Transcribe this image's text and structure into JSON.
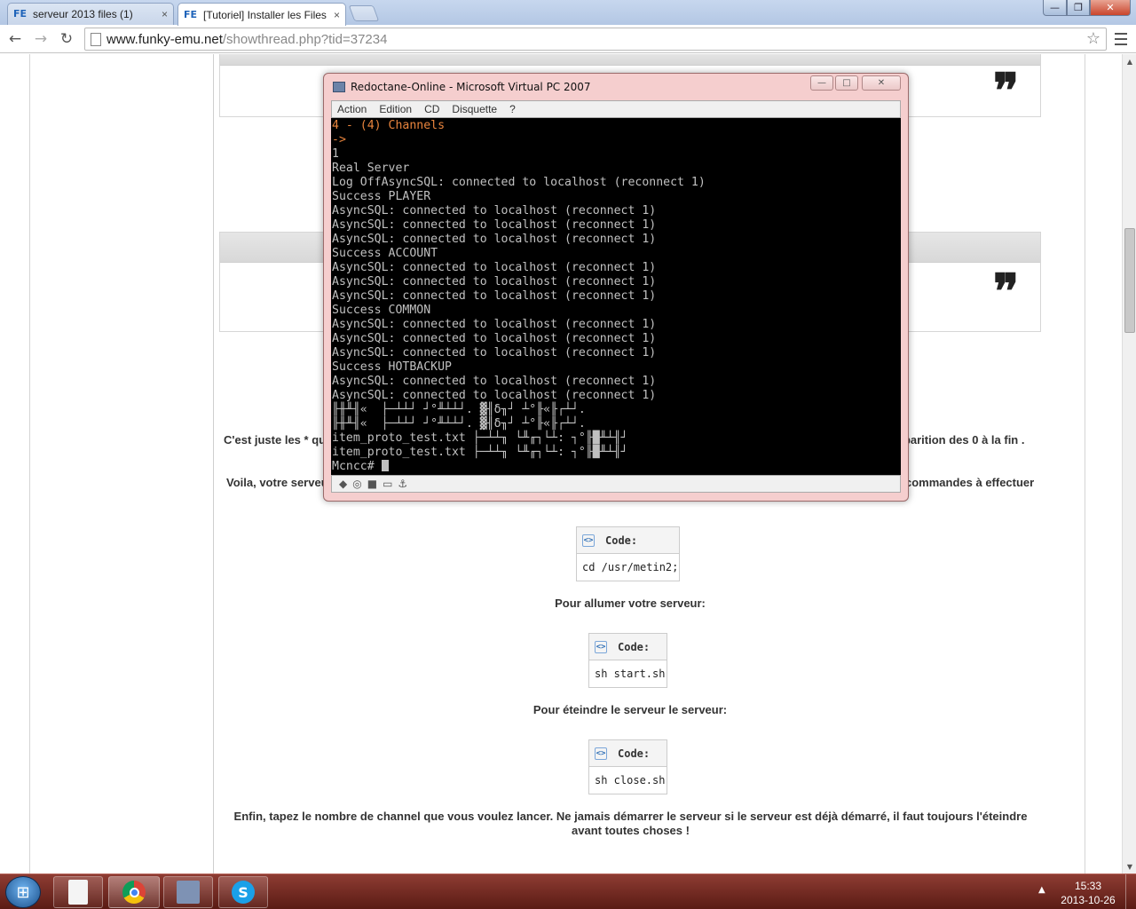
{
  "browser": {
    "tabs": [
      {
        "label": "serveur 2013 files (1)",
        "favicon": "FE",
        "close": "×"
      },
      {
        "label": "[Tutoriel] Installer les Files",
        "favicon": "FE",
        "close": "×"
      }
    ],
    "window_controls": {
      "minimize": "—",
      "maximize": "❐",
      "close": "✕"
    },
    "nav": {
      "back": "←",
      "forward": "→",
      "reload": "↻"
    },
    "url_host": "www.funky-emu.net",
    "url_path": "/showthread.php?tid=37234",
    "star": "☆"
  },
  "page": {
    "quote_mark": "❞",
    "para1_left": "C'est juste les * qu",
    "para1_right": "pparition des 0 à la fin .",
    "para2_left": "Voila, votre serveu",
    "para2_right": "commandes à effectuer",
    "code_label": "Code:",
    "code_icon": "<>",
    "code1": "cd /usr/metin2;",
    "label_start": "Pour allumer votre serveur:",
    "code2": "sh start.sh",
    "label_stop": "Pour éteindre le serveur le serveur:",
    "code3": "sh close.sh",
    "final_text": "Enfin, tapez le nombre de channel que vous voulez lancer. Ne jamais démarrer le serveur si le serveur est déjà démarré, il faut toujours l'éteindre avant toutes choses !"
  },
  "vpc": {
    "title": "Redoctane-Online - Microsoft Virtual PC 2007",
    "buttons": {
      "minimize": "—",
      "maximize": "□",
      "close": "✕"
    },
    "menu": [
      "Action",
      "Edition",
      "CD",
      "Disquette",
      "?"
    ],
    "console_lines": [
      {
        "text": "4 - (4) Channels",
        "color": "orange"
      },
      {
        "text": "->",
        "color": "orange"
      },
      {
        "text": "1",
        "color": "gray"
      },
      {
        "text": "Real Server",
        "color": "gray"
      },
      {
        "text": "Log OffAsyncSQL: connected to localhost (reconnect 1)",
        "color": "gray"
      },
      {
        "text": "Success PLAYER",
        "color": "gray"
      },
      {
        "text": "AsyncSQL: connected to localhost (reconnect 1)",
        "color": "gray"
      },
      {
        "text": "AsyncSQL: connected to localhost (reconnect 1)",
        "color": "gray"
      },
      {
        "text": "AsyncSQL: connected to localhost (reconnect 1)",
        "color": "gray"
      },
      {
        "text": "Success ACCOUNT",
        "color": "gray"
      },
      {
        "text": "AsyncSQL: connected to localhost (reconnect 1)",
        "color": "gray"
      },
      {
        "text": "AsyncSQL: connected to localhost (reconnect 1)",
        "color": "gray"
      },
      {
        "text": "AsyncSQL: connected to localhost (reconnect 1)",
        "color": "gray"
      },
      {
        "text": "Success COMMON",
        "color": "gray"
      },
      {
        "text": "AsyncSQL: connected to localhost (reconnect 1)",
        "color": "gray"
      },
      {
        "text": "AsyncSQL: connected to localhost (reconnect 1)",
        "color": "gray"
      },
      {
        "text": "AsyncSQL: connected to localhost (reconnect 1)",
        "color": "gray"
      },
      {
        "text": "Success HOTBACKUP",
        "color": "gray"
      },
      {
        "text": "AsyncSQL: connected to localhost (reconnect 1)",
        "color": "gray"
      },
      {
        "text": "AsyncSQL: connected to localhost (reconnect 1)",
        "color": "gray"
      },
      {
        "text": "╟╫╨╢«  ├─┴┴┘ ┘°╨┴┴┘. ▓╢δ╖┘ ┴°╟«╟┌┴┘.",
        "color": "gray"
      },
      {
        "text": "╟╫╨╢«  ├─┴┴┘ ┘°╨┴┴┘. ▓╢δ╖┘ ┴°╟«╟┌┴┘.",
        "color": "gray"
      },
      {
        "text": "item_proto_test.txt ├─┴┴╖ └╨╓┐└┴: ┐°╟█╨┴╢┘",
        "color": "gray"
      },
      {
        "text": "item_proto_test.txt ├─┴┴╖ └╨╓┐└┴: ┐°╟█╨┴╢┘",
        "color": "gray"
      }
    ],
    "prompt": "Mcncc# ",
    "status_icons": [
      "◆",
      "◎",
      "■",
      "▭",
      "⚓"
    ]
  },
  "taskbar": {
    "start": "⊞",
    "time": "15:33",
    "date": "2013-10-26",
    "tray_arrow": "▲",
    "skype_letter": "S"
  },
  "scrollbar": {
    "up": "▲",
    "down": "▼"
  }
}
